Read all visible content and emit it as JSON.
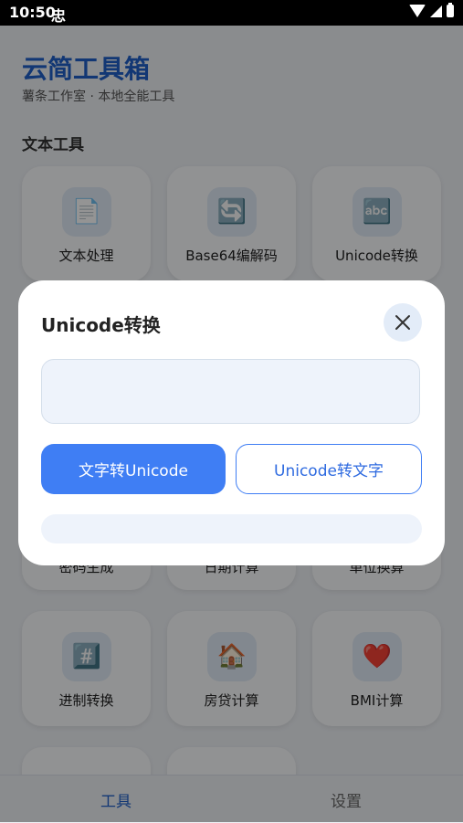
{
  "status_bar": {
    "time": "10:50",
    "app_glyph": "忠"
  },
  "header": {
    "title": "云简工具箱",
    "subtitle": "薯条工作室 · 本地全能工具"
  },
  "section_title": "文本工具",
  "tools": [
    {
      "label": "文本处理",
      "icon": "📄"
    },
    {
      "label": "Base64编解码",
      "icon": "🔄"
    },
    {
      "label": "Unicode转换",
      "icon": "🔤"
    },
    {
      "label": "密码生成",
      "icon": ""
    },
    {
      "label": "日期计算",
      "icon": ""
    },
    {
      "label": "单位换算",
      "icon": ""
    },
    {
      "label": "进制转换",
      "icon": "#️⃣"
    },
    {
      "label": "房贷计算",
      "icon": "🏠"
    },
    {
      "label": "BMI计算",
      "icon": "❤️"
    }
  ],
  "bottom_nav": {
    "tools": "工具",
    "settings": "设置"
  },
  "dialog": {
    "title": "Unicode转换",
    "input_value": "",
    "btn_to_unicode": "文字转Unicode",
    "btn_to_text": "Unicode转文字",
    "output_value": ""
  }
}
